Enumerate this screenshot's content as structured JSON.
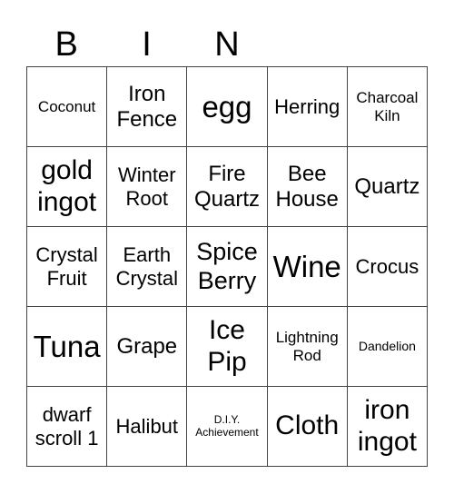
{
  "header": {
    "letters": [
      "B",
      "I",
      "N",
      "",
      ""
    ]
  },
  "cells": [
    [
      "Coconut",
      "Iron Fence",
      "egg",
      "Herring",
      "Charcoal Kiln"
    ],
    [
      "gold ingot",
      "Winter Root",
      "Fire Quartz",
      "Bee House",
      "Quartz"
    ],
    [
      "Crystal Fruit",
      "Earth Crystal",
      "Spice Berry",
      "Wine",
      "Crocus"
    ],
    [
      "Tuna",
      "Grape",
      "Ice Pip",
      "Lightning Rod",
      "Dandelion"
    ],
    [
      "dwarf scroll 1",
      "Halibut",
      "D.I.Y. Achievement",
      "Cloth",
      "iron ingot"
    ]
  ]
}
